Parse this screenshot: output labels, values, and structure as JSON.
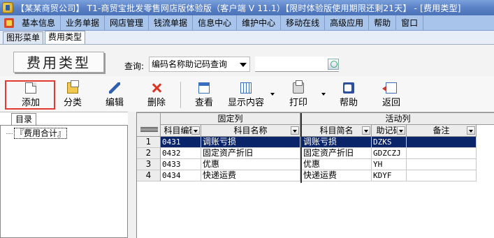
{
  "window": {
    "title": "【某某商贸公司】 T1-商贸宝批发零售网店版体验版（客户端 V 11.1）【限时体验版使用期限还剩21天】 - [费用类型]"
  },
  "menu": {
    "items": [
      "基本信息",
      "业务单据",
      "网店管理",
      "钱流单据",
      "信息中心",
      "维护中心",
      "移动在线",
      "高级应用",
      "帮助",
      "窗口"
    ]
  },
  "tabs": [
    {
      "label": "图形菜单",
      "active": false
    },
    {
      "label": "费用类型",
      "active": true
    }
  ],
  "form": {
    "title": "费用类型",
    "query_label": "查询:",
    "query_mode": "编码名称助记码查询",
    "query_value": ""
  },
  "toolbar": {
    "add": "添加",
    "category": "分类",
    "edit": "编辑",
    "delete": "删除",
    "view": "查看",
    "display": "显示内容",
    "print": "打印",
    "help": "帮助",
    "back": "返回"
  },
  "tree": {
    "tab_label": "目录",
    "root": "『费用合计』"
  },
  "grid": {
    "band_fixed": "固定列",
    "band_active": "活动列",
    "columns": {
      "code": "科目编码",
      "name": "科目名称",
      "short": "科目简名",
      "mnemonic": "助记码",
      "remark": "备注"
    },
    "rows": [
      {
        "no": "1",
        "code": "0431",
        "name": "调账亏损",
        "short": "调账亏损",
        "mnemonic": "DZKS",
        "remark": ""
      },
      {
        "no": "2",
        "code": "0432",
        "name": "固定资产折旧",
        "short": "固定资产折旧",
        "mnemonic": "GDZCZJ",
        "remark": ""
      },
      {
        "no": "3",
        "code": "0433",
        "name": "优惠",
        "short": "优惠",
        "mnemonic": "YH",
        "remark": ""
      },
      {
        "no": "4",
        "code": "0434",
        "name": "快递运费",
        "short": "快递运费",
        "mnemonic": "KDYF",
        "remark": ""
      }
    ],
    "selected_row": 1
  },
  "colors": {
    "selection": "#0a246a",
    "highlight_box": "#e53935",
    "menubar": "#a9c4ea"
  }
}
